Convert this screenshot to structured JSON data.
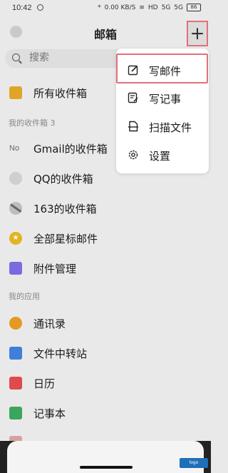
{
  "status_bar": {
    "time": "10:42",
    "indicators": [
      "*",
      "0.00 KB/S",
      "wifi",
      "HD",
      "5G",
      "5G"
    ],
    "battery": "86"
  },
  "header": {
    "title": "邮箱",
    "add_button": "+"
  },
  "search": {
    "placeholder": "搜索"
  },
  "all_inbox": {
    "label": "所有收件箱"
  },
  "sections": {
    "my_inboxes": "我的收件箱 3",
    "my_apps": "我的应用"
  },
  "inboxes": [
    {
      "icon": "gmail-icon",
      "icon_text": "No",
      "label": "Gmail的收件箱"
    },
    {
      "icon": "qq-mail-icon",
      "label": "QQ的收件箱"
    },
    {
      "icon": "163-mail-icon",
      "label": "163的收件箱"
    },
    {
      "icon": "star-icon",
      "label": "全部星标邮件"
    },
    {
      "icon": "attachment-icon",
      "label": "附件管理"
    }
  ],
  "apps": [
    {
      "icon": "contacts-icon",
      "label": "通讯录"
    },
    {
      "icon": "file-transfer-icon",
      "label": "文件中转站"
    },
    {
      "icon": "calendar-icon",
      "label": "日历"
    },
    {
      "icon": "notebook-icon",
      "label": "记事本"
    }
  ],
  "menu": {
    "items": [
      {
        "icon": "edit-icon",
        "label": "写邮件"
      },
      {
        "icon": "note-edit-icon",
        "label": "写记事"
      },
      {
        "icon": "scan-icon",
        "label": "扫描文件"
      },
      {
        "icon": "gear-icon",
        "label": "设置"
      }
    ]
  },
  "colors": {
    "highlight": "#e0707a",
    "inbox_icon": "#e0a528",
    "star_icon": "#e3b421",
    "attachment_icon": "#7a6be0",
    "contacts_icon": "#e39a22",
    "transfer_icon": "#3f7fd8",
    "calendar_icon": "#e04a4a",
    "notebook_icon": "#3aa55c"
  }
}
